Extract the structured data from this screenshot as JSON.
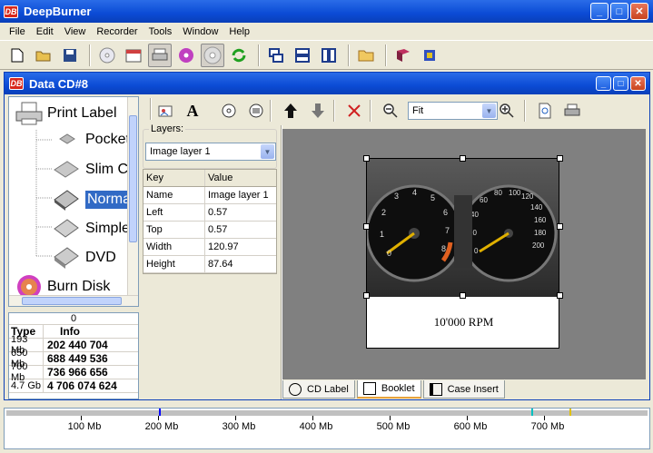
{
  "app": {
    "title": "DeepBurner",
    "logo_text": "DB"
  },
  "menu": [
    "File",
    "Edit",
    "View",
    "Recorder",
    "Tools",
    "Window",
    "Help"
  ],
  "toolbar": {
    "icons": [
      "new-icon",
      "open-icon",
      "save-icon",
      "cd-icon",
      "calendar-icon",
      "printer-icon",
      "multimedia-disc-icon",
      "disc-gray-icon",
      "refresh-icon",
      "cascade-icon",
      "tile-horizontal-icon",
      "tile-vertical-icon",
      "folder-icon",
      "book-icon",
      "help-cube-icon"
    ]
  },
  "doc": {
    "title": "Data CD#8"
  },
  "tree": {
    "print_label": "Print Label",
    "children": [
      "Pocket",
      "Slim Cl",
      "Normal",
      "Simple",
      "DVD"
    ],
    "selected": "Normal",
    "burn_disk": "Burn Disk"
  },
  "info": {
    "counter": "0",
    "headers": [
      "Type",
      "Info"
    ],
    "rows": [
      {
        "type": "193 Mb",
        "info": "202 440 704"
      },
      {
        "type": "650 Mb",
        "info": "688 449 536"
      },
      {
        "type": "700 Mb",
        "info": "736 966 656"
      },
      {
        "type": "4.7 Gb",
        "info": "4 706 074 624"
      }
    ]
  },
  "layers": {
    "label": "Layers:",
    "selected": "Image layer 1",
    "headers": [
      "Key",
      "Value"
    ],
    "rows": [
      {
        "k": "Name",
        "v": "Image layer 1"
      },
      {
        "k": "Left",
        "v": "0.57"
      },
      {
        "k": "Top",
        "v": "0.57"
      },
      {
        "k": "Width",
        "v": "120.97"
      },
      {
        "k": "Height",
        "v": "87.64"
      }
    ]
  },
  "zoom": {
    "value": "Fit"
  },
  "label_caption": "10'000 RPM",
  "tabs": [
    "CD Label",
    "Booklet",
    "Case Insert"
  ],
  "active_tab": "Booklet",
  "ruler": {
    "labels": [
      "100 Mb",
      "200 Mb",
      "300 Mb",
      "400 Mb",
      "500 Mb",
      "600 Mb",
      "700 Mb"
    ]
  },
  "colors": {
    "titlebar": "#0b4bd5",
    "selection": "#316ac5",
    "marker_blue": "#0000ff",
    "marker_cyan": "#00c0c0",
    "marker_yellow": "#e0c000"
  }
}
